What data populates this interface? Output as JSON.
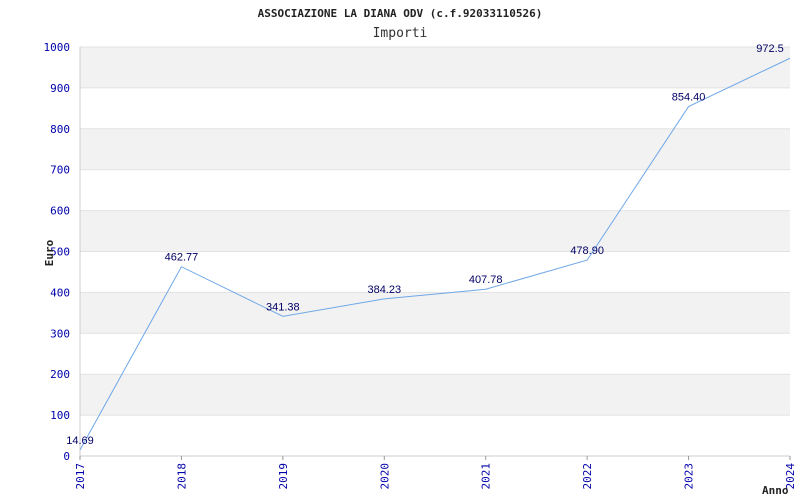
{
  "chart_data": {
    "type": "line",
    "title": "ASSOCIAZIONE LA DIANA ODV (c.f.92033110526)",
    "subtitle": "Importi",
    "xlabel": "Anno",
    "ylabel": "Euro",
    "categories": [
      "2017",
      "2018",
      "2019",
      "2020",
      "2021",
      "2022",
      "2023",
      "2024"
    ],
    "series": [
      {
        "values": [
          14.69,
          462.77,
          341.38,
          384.23,
          407.78,
          478.9,
          854.4,
          972.5
        ]
      }
    ],
    "data_labels": [
      "14.69",
      "462.77",
      "341.38",
      "384.23",
      "407.78",
      "478.90",
      "854.40",
      "972.5"
    ],
    "ylim": [
      0,
      1000
    ],
    "yticks": [
      0,
      100,
      200,
      300,
      400,
      500,
      600,
      700,
      800,
      900,
      1000
    ],
    "grid": "horizontal bands",
    "legend": "none",
    "colors": {
      "line": "#6fa8e8",
      "band": "#f2f2f2",
      "tick": "#0000aa",
      "label": "#000066"
    }
  }
}
